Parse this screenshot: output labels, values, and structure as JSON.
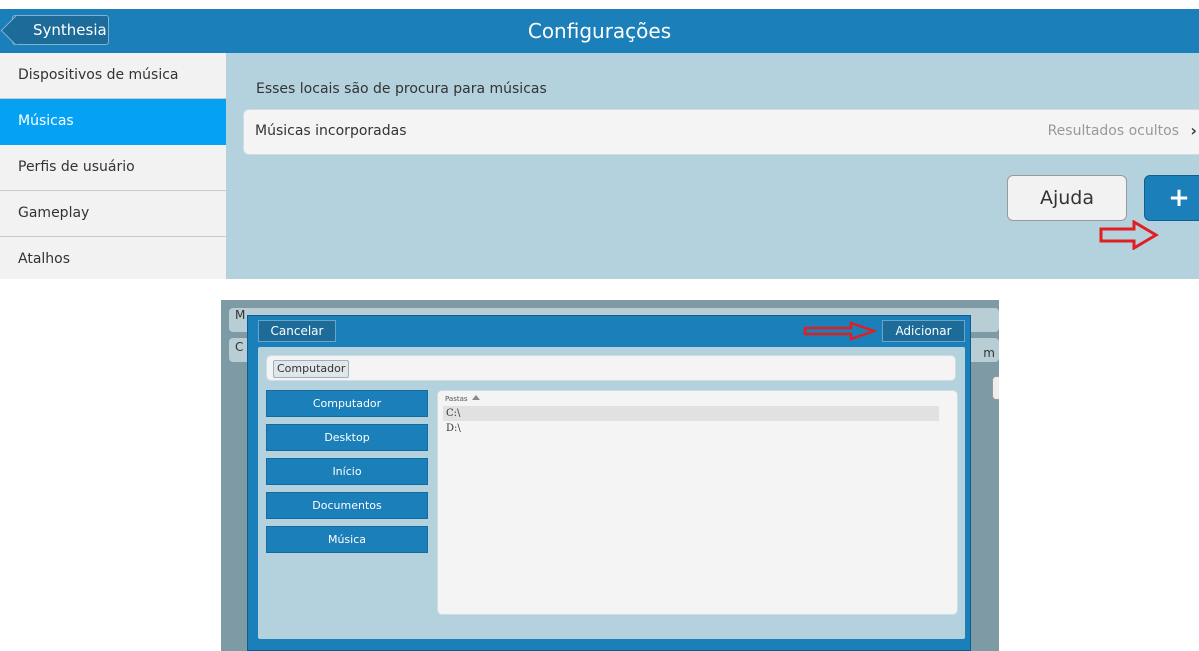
{
  "top": {
    "back_label": "Synthesia",
    "title": "Configurações",
    "sidebar": {
      "items": [
        {
          "label": "Dispositivos de música",
          "active": false
        },
        {
          "label": "Músicas",
          "active": true
        },
        {
          "label": "Perfis de usuário",
          "active": false
        },
        {
          "label": "Gameplay",
          "active": false
        },
        {
          "label": "Atalhos",
          "active": false
        }
      ]
    },
    "content": {
      "description": "Esses locais são de procura para músicas",
      "music_row": {
        "label": "Músicas incorporadas",
        "status": "Resultados ocultos"
      },
      "help_label": "Ajuda",
      "add_label": "+"
    }
  },
  "bottom": {
    "background_row_texts": {
      "m": "M",
      "c": "C",
      "m_right": "m"
    },
    "dialog": {
      "cancel_label": "Cancelar",
      "add_label": "Adicionar",
      "path_crumb": "Computador",
      "locations": [
        "Computador",
        "Desktop",
        "Início",
        "Documentos",
        "Música"
      ],
      "list_header": "Pastas",
      "folders": [
        {
          "name": "C:\\",
          "selected": true
        },
        {
          "name": "D:\\",
          "selected": false
        }
      ]
    }
  },
  "colors": {
    "accent_blue": "#1b7fb9",
    "selected_blue": "#05a2f4",
    "panel": "#b4d2dd",
    "annotation_arrow": "#e02020"
  },
  "annotations": [
    "red-arrow-pointing-to-add-button",
    "red-arrow-pointing-to-adicionar-button"
  ]
}
